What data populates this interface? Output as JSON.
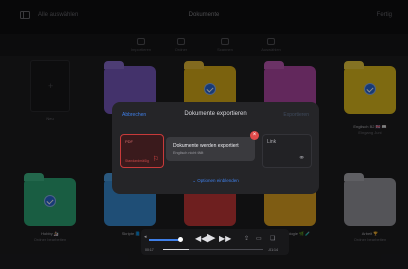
{
  "topbar": {
    "back_label": "Alle auswählen",
    "title": "Dokumente",
    "done_label": "Fertig"
  },
  "actions": [
    {
      "label": "Importieren",
      "icon": "import-icon"
    },
    {
      "label": "Ordner",
      "icon": "folder-add-icon"
    },
    {
      "label": "Scannen",
      "icon": "scan-icon"
    },
    {
      "label": "Auswählen",
      "icon": "select-icon"
    }
  ],
  "newdoc_label": "Neu",
  "folders": {
    "row1": [
      {
        "color": "#7a5cc4",
        "label": ""
      },
      {
        "color": "#e0b21a",
        "label": ""
      },
      {
        "color": "#b24aa8",
        "label": ""
      },
      {
        "color": "#e6c21f",
        "label": "Englisch B2 🇬🇧 📖",
        "sublabel": "Eingang Juni"
      }
    ],
    "row2": [
      {
        "color": "#2faa78",
        "label": "Hobby 🏂",
        "sublabel": "Ordner bearbeiten"
      },
      {
        "color": "#3a8fd8",
        "label": "Skripte 📘",
        "sublabel": ""
      },
      {
        "color": "#c83a3a",
        "label": "",
        "sublabel": ""
      },
      {
        "color": "#e6a823",
        "label": "Biologie 🌿 🧪",
        "sublabel": ""
      },
      {
        "color": "#9a9aa0",
        "label": "Arbeit 🏆",
        "sublabel": "Ordner bearbeiten"
      }
    ]
  },
  "dialog": {
    "cancel_label": "Abbrechen",
    "title": "Dokumente exportieren",
    "export_label": "Exportieren",
    "formats": [
      {
        "label": "PDF",
        "sub": "Standardmäßig",
        "icon": "pdf-icon",
        "selected": true
      },
      {
        "label": "Link",
        "icon": "link-icon",
        "selected": false
      }
    ],
    "options_label": "Optionen einblenden"
  },
  "popup": {
    "title": "Dokumente werden exportiert",
    "subtitle": "Englisch nicht fällt"
  },
  "player": {
    "time_elapsed": "00:17",
    "time_remaining": "-01:14",
    "progress": 0.26,
    "volume": 0.9
  }
}
